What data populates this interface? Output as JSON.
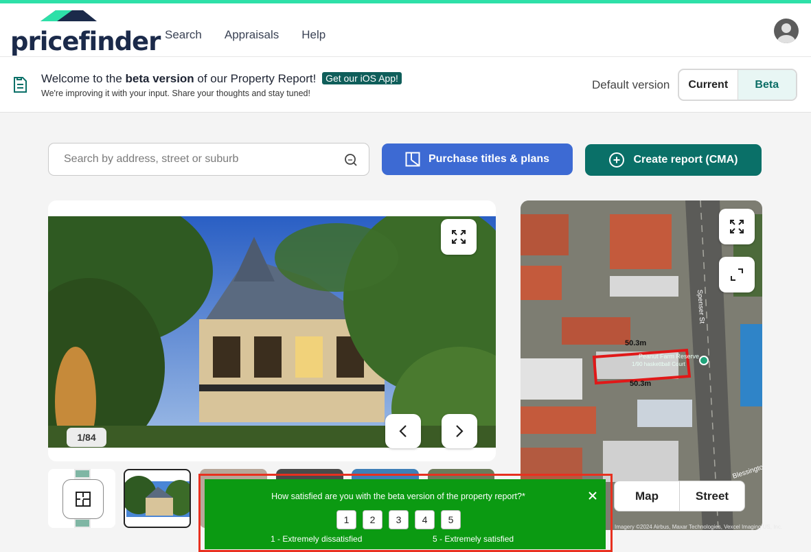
{
  "header": {
    "logo_text": "pricefinder",
    "nav": [
      "Search",
      "Appraisals",
      "Help"
    ]
  },
  "banner": {
    "title_prefix": "Welcome to the ",
    "title_bold": "beta version",
    "title_suffix": " of our Property Report!",
    "ios_badge": "Get our iOS App!",
    "subtitle": "We're improving it with your input. Share your thoughts and stay tuned!",
    "default_label": "Default version",
    "toggle_current": "Current",
    "toggle_beta": "Beta",
    "selected": "Beta"
  },
  "search": {
    "placeholder": "Search by address, street or suburb"
  },
  "actions": {
    "purchase_label": "Purchase titles & plans",
    "create_label": "Create report (CMA)"
  },
  "gallery": {
    "counter": "1/84"
  },
  "map": {
    "measure_top": "50.3m",
    "measure_bottom": "50.3m",
    "street_label": "Spenser St",
    "poi_label": "Peanut Farm Reserve",
    "poi_sub": "1/90 haskettball Court",
    "street_label_2": "Blessington",
    "tab_map": "Map",
    "tab_street": "Street",
    "credit": "Imagery ©2024 Airbus, Maxar Technologies, Vexcel Imaging US, Inc."
  },
  "survey": {
    "question": "How satisfied are you with the beta version of the property report?*",
    "options": [
      "1",
      "2",
      "3",
      "4",
      "5"
    ],
    "low_label": "1 - Extremely dissatisfied",
    "high_label": "5 - Extremely satisfied"
  },
  "colors": {
    "accent_top": "#2ee0a8",
    "purchase_button": "#3d6ad3",
    "create_button": "#0a7068",
    "survey_bg": "#0b9a12",
    "survey_outline": "#e8301f"
  }
}
